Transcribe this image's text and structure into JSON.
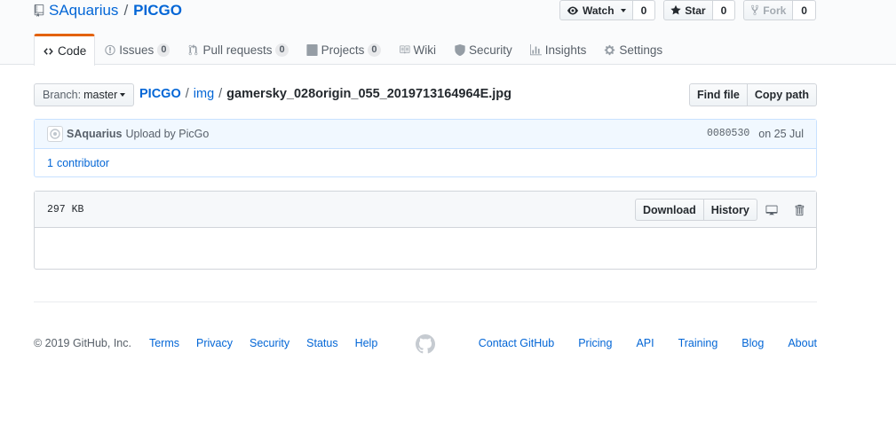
{
  "repo": {
    "owner": "SAquarius",
    "separator": "/",
    "name": "PICGO"
  },
  "actions": {
    "watch": {
      "label": "Watch",
      "count": "0"
    },
    "star": {
      "label": "Star",
      "count": "0"
    },
    "fork": {
      "label": "Fork",
      "count": "0"
    }
  },
  "nav": {
    "code": "Code",
    "issues": {
      "label": "Issues",
      "count": "0"
    },
    "pulls": {
      "label": "Pull requests",
      "count": "0"
    },
    "projects": {
      "label": "Projects",
      "count": "0"
    },
    "wiki": "Wiki",
    "security": "Security",
    "insights": "Insights",
    "settings": "Settings"
  },
  "file_nav": {
    "branch_prefix": "Branch:",
    "branch": "master",
    "root": "PICGO",
    "folder": "img",
    "filename": "gamersky_028origin_055_2019713164964E.jpg",
    "find_file": "Find file",
    "copy_path": "Copy path"
  },
  "commit": {
    "author": "SAquarius",
    "message": "Upload by PicGo",
    "sha": "0080530",
    "date": "on 25 Jul",
    "contributors_count": "1",
    "contributors_label": "contributor"
  },
  "file": {
    "size": "297 KB",
    "download": "Download",
    "history": "History"
  },
  "footer": {
    "copyright": "© 2019 GitHub, Inc.",
    "left_links": [
      "Terms",
      "Privacy",
      "Security",
      "Status",
      "Help"
    ],
    "right_links": [
      "Contact GitHub",
      "Pricing",
      "API",
      "Training",
      "Blog",
      "About"
    ]
  },
  "colors": {
    "link": "#0366d6",
    "accent_tab": "#e36209",
    "commit_bg": "#f1f8ff"
  }
}
